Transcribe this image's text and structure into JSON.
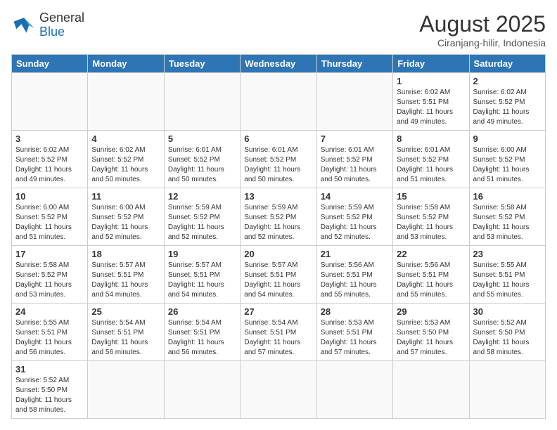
{
  "header": {
    "logo_general": "General",
    "logo_blue": "Blue",
    "month_title": "August 2025",
    "location": "Ciranjang-hilir, Indonesia"
  },
  "weekdays": [
    "Sunday",
    "Monday",
    "Tuesday",
    "Wednesday",
    "Thursday",
    "Friday",
    "Saturday"
  ],
  "weeks": [
    [
      {
        "day": "",
        "info": ""
      },
      {
        "day": "",
        "info": ""
      },
      {
        "day": "",
        "info": ""
      },
      {
        "day": "",
        "info": ""
      },
      {
        "day": "",
        "info": ""
      },
      {
        "day": "1",
        "info": "Sunrise: 6:02 AM\nSunset: 5:51 PM\nDaylight: 11 hours\nand 49 minutes."
      },
      {
        "day": "2",
        "info": "Sunrise: 6:02 AM\nSunset: 5:52 PM\nDaylight: 11 hours\nand 49 minutes."
      }
    ],
    [
      {
        "day": "3",
        "info": "Sunrise: 6:02 AM\nSunset: 5:52 PM\nDaylight: 11 hours\nand 49 minutes."
      },
      {
        "day": "4",
        "info": "Sunrise: 6:02 AM\nSunset: 5:52 PM\nDaylight: 11 hours\nand 50 minutes."
      },
      {
        "day": "5",
        "info": "Sunrise: 6:01 AM\nSunset: 5:52 PM\nDaylight: 11 hours\nand 50 minutes."
      },
      {
        "day": "6",
        "info": "Sunrise: 6:01 AM\nSunset: 5:52 PM\nDaylight: 11 hours\nand 50 minutes."
      },
      {
        "day": "7",
        "info": "Sunrise: 6:01 AM\nSunset: 5:52 PM\nDaylight: 11 hours\nand 50 minutes."
      },
      {
        "day": "8",
        "info": "Sunrise: 6:01 AM\nSunset: 5:52 PM\nDaylight: 11 hours\nand 51 minutes."
      },
      {
        "day": "9",
        "info": "Sunrise: 6:00 AM\nSunset: 5:52 PM\nDaylight: 11 hours\nand 51 minutes."
      }
    ],
    [
      {
        "day": "10",
        "info": "Sunrise: 6:00 AM\nSunset: 5:52 PM\nDaylight: 11 hours\nand 51 minutes."
      },
      {
        "day": "11",
        "info": "Sunrise: 6:00 AM\nSunset: 5:52 PM\nDaylight: 11 hours\nand 52 minutes."
      },
      {
        "day": "12",
        "info": "Sunrise: 5:59 AM\nSunset: 5:52 PM\nDaylight: 11 hours\nand 52 minutes."
      },
      {
        "day": "13",
        "info": "Sunrise: 5:59 AM\nSunset: 5:52 PM\nDaylight: 11 hours\nand 52 minutes."
      },
      {
        "day": "14",
        "info": "Sunrise: 5:59 AM\nSunset: 5:52 PM\nDaylight: 11 hours\nand 52 minutes."
      },
      {
        "day": "15",
        "info": "Sunrise: 5:58 AM\nSunset: 5:52 PM\nDaylight: 11 hours\nand 53 minutes."
      },
      {
        "day": "16",
        "info": "Sunrise: 5:58 AM\nSunset: 5:52 PM\nDaylight: 11 hours\nand 53 minutes."
      }
    ],
    [
      {
        "day": "17",
        "info": "Sunrise: 5:58 AM\nSunset: 5:52 PM\nDaylight: 11 hours\nand 53 minutes."
      },
      {
        "day": "18",
        "info": "Sunrise: 5:57 AM\nSunset: 5:51 PM\nDaylight: 11 hours\nand 54 minutes."
      },
      {
        "day": "19",
        "info": "Sunrise: 5:57 AM\nSunset: 5:51 PM\nDaylight: 11 hours\nand 54 minutes."
      },
      {
        "day": "20",
        "info": "Sunrise: 5:57 AM\nSunset: 5:51 PM\nDaylight: 11 hours\nand 54 minutes."
      },
      {
        "day": "21",
        "info": "Sunrise: 5:56 AM\nSunset: 5:51 PM\nDaylight: 11 hours\nand 55 minutes."
      },
      {
        "day": "22",
        "info": "Sunrise: 5:56 AM\nSunset: 5:51 PM\nDaylight: 11 hours\nand 55 minutes."
      },
      {
        "day": "23",
        "info": "Sunrise: 5:55 AM\nSunset: 5:51 PM\nDaylight: 11 hours\nand 55 minutes."
      }
    ],
    [
      {
        "day": "24",
        "info": "Sunrise: 5:55 AM\nSunset: 5:51 PM\nDaylight: 11 hours\nand 56 minutes."
      },
      {
        "day": "25",
        "info": "Sunrise: 5:54 AM\nSunset: 5:51 PM\nDaylight: 11 hours\nand 56 minutes."
      },
      {
        "day": "26",
        "info": "Sunrise: 5:54 AM\nSunset: 5:51 PM\nDaylight: 11 hours\nand 56 minutes."
      },
      {
        "day": "27",
        "info": "Sunrise: 5:54 AM\nSunset: 5:51 PM\nDaylight: 11 hours\nand 57 minutes."
      },
      {
        "day": "28",
        "info": "Sunrise: 5:53 AM\nSunset: 5:51 PM\nDaylight: 11 hours\nand 57 minutes."
      },
      {
        "day": "29",
        "info": "Sunrise: 5:53 AM\nSunset: 5:50 PM\nDaylight: 11 hours\nand 57 minutes."
      },
      {
        "day": "30",
        "info": "Sunrise: 5:52 AM\nSunset: 5:50 PM\nDaylight: 11 hours\nand 58 minutes."
      }
    ],
    [
      {
        "day": "31",
        "info": "Sunrise: 5:52 AM\nSunset: 5:50 PM\nDaylight: 11 hours\nand 58 minutes."
      },
      {
        "day": "",
        "info": ""
      },
      {
        "day": "",
        "info": ""
      },
      {
        "day": "",
        "info": ""
      },
      {
        "day": "",
        "info": ""
      },
      {
        "day": "",
        "info": ""
      },
      {
        "day": "",
        "info": ""
      }
    ]
  ]
}
